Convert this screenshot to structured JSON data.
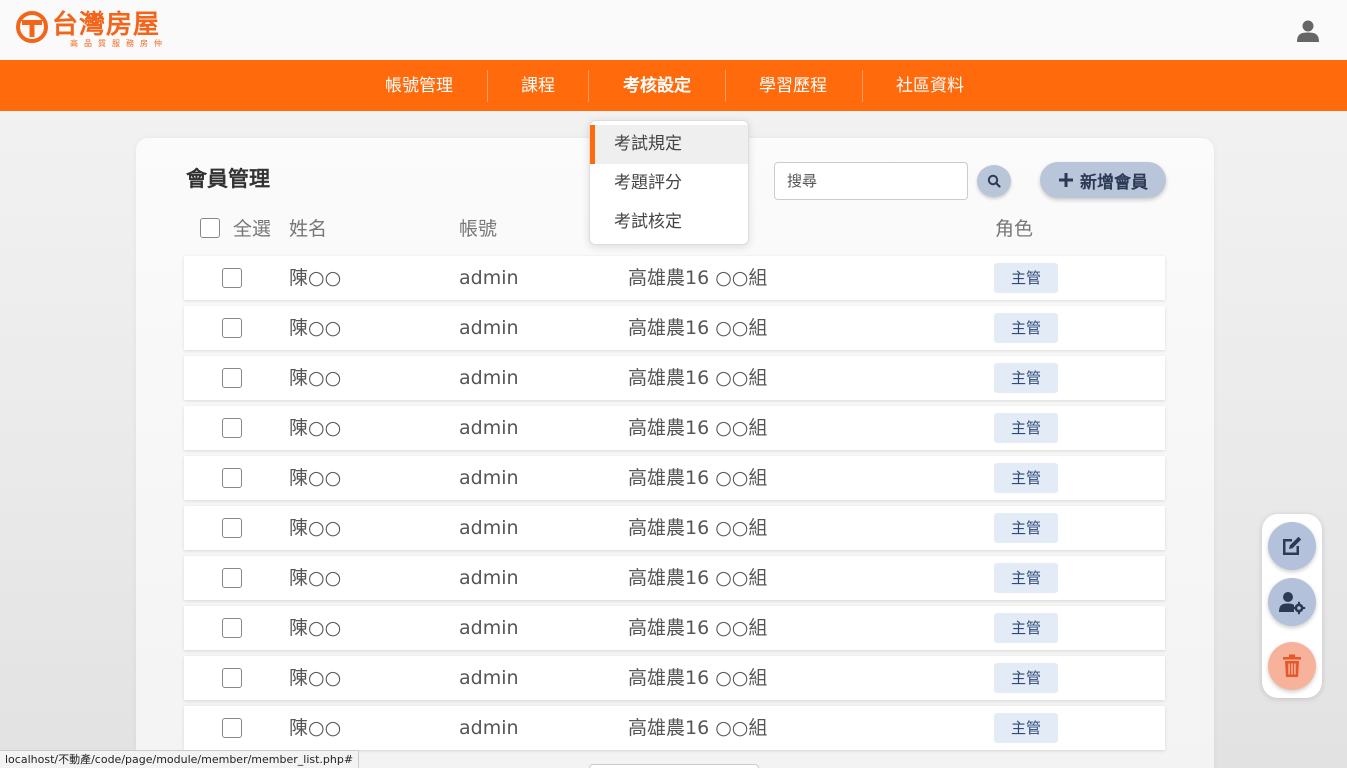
{
  "header": {
    "logo_title": "台灣房屋",
    "logo_slogan": "高品質服務房仲",
    "brand_color": "#ff6a0d"
  },
  "nav": {
    "items": [
      {
        "label": "帳號管理"
      },
      {
        "label": "課程"
      },
      {
        "label": "考核設定",
        "active": true
      },
      {
        "label": "學習歷程"
      },
      {
        "label": "社區資料"
      }
    ]
  },
  "dropdown": {
    "items": [
      {
        "label": "考試規定",
        "active": true
      },
      {
        "label": "考題評分"
      },
      {
        "label": "考試核定"
      }
    ]
  },
  "main": {
    "title": "會員管理",
    "search_placeholder": "搜尋",
    "add_label": "新增會員",
    "columns": {
      "select_all": "全選",
      "name": "姓名",
      "account": "帳號",
      "role": "角色"
    },
    "rows": [
      {
        "name": "陳○○",
        "account": "admin",
        "unit": "高雄農16 ○○組",
        "role": "主管"
      },
      {
        "name": "陳○○",
        "account": "admin",
        "unit": "高雄農16 ○○組",
        "role": "主管"
      },
      {
        "name": "陳○○",
        "account": "admin",
        "unit": "高雄農16 ○○組",
        "role": "主管"
      },
      {
        "name": "陳○○",
        "account": "admin",
        "unit": "高雄農16 ○○組",
        "role": "主管"
      },
      {
        "name": "陳○○",
        "account": "admin",
        "unit": "高雄農16 ○○組",
        "role": "主管"
      },
      {
        "name": "陳○○",
        "account": "admin",
        "unit": "高雄農16 ○○組",
        "role": "主管"
      },
      {
        "name": "陳○○",
        "account": "admin",
        "unit": "高雄農16 ○○組",
        "role": "主管"
      },
      {
        "name": "陳○○",
        "account": "admin",
        "unit": "高雄農16 ○○組",
        "role": "主管"
      },
      {
        "name": "陳○○",
        "account": "admin",
        "unit": "高雄農16 ○○組",
        "role": "主管"
      },
      {
        "name": "陳○○",
        "account": "admin",
        "unit": "高雄農16 ○○組",
        "role": "主管"
      }
    ]
  },
  "fab": {
    "icons": [
      "edit-icon",
      "user-settings-icon",
      "trash-icon"
    ]
  },
  "statusbar": {
    "url": "localhost/不動產/code/page/module/member/member_list.php#"
  }
}
